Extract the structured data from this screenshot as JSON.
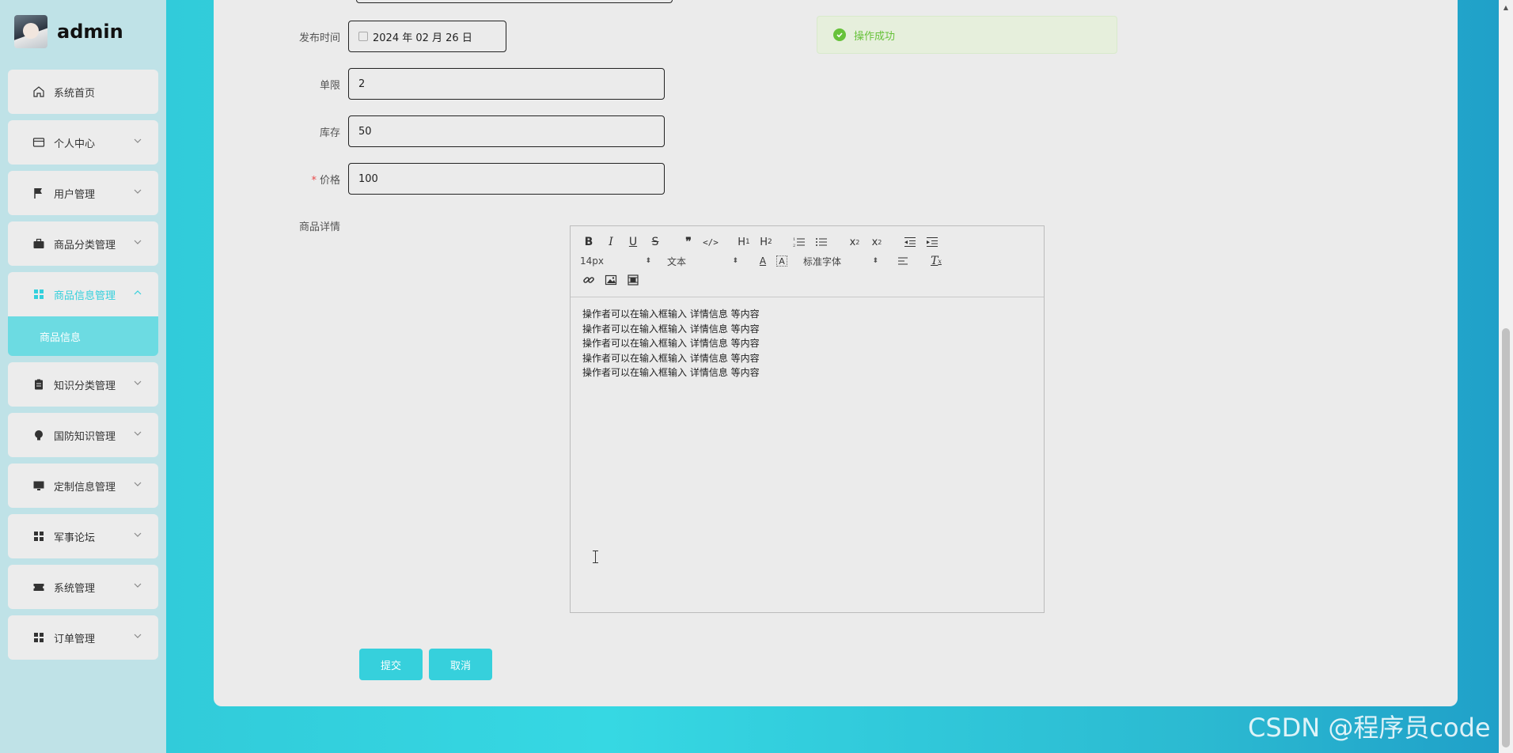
{
  "brand": {
    "name": "admin"
  },
  "sidebar": {
    "items": [
      {
        "label": "系统首页",
        "icon": "home-icon"
      },
      {
        "label": "个人中心",
        "icon": "id-card-icon"
      },
      {
        "label": "用户管理",
        "icon": "flag-icon"
      },
      {
        "label": "商品分类管理",
        "icon": "briefcase-icon"
      },
      {
        "label": "商品信息管理",
        "icon": "grid-icon"
      },
      {
        "label": "知识分类管理",
        "icon": "clipboard-icon"
      },
      {
        "label": "国防知识管理",
        "icon": "bulb-icon"
      },
      {
        "label": "定制信息管理",
        "icon": "monitor-icon"
      },
      {
        "label": "军事论坛",
        "icon": "grid-icon"
      },
      {
        "label": "系统管理",
        "icon": "ticket-icon"
      },
      {
        "label": "订单管理",
        "icon": "grid-icon"
      }
    ],
    "active_sub": "商品信息"
  },
  "form": {
    "publish_time": {
      "label": "发布时间",
      "value": "2024 年 02 月 26 日"
    },
    "limit": {
      "label": "单限",
      "value": "2"
    },
    "stock": {
      "label": "库存",
      "value": "50"
    },
    "price": {
      "label": "价格",
      "value": "100",
      "required_mark": "*"
    },
    "detail": {
      "label": "商品详情"
    }
  },
  "toast": {
    "text": "操作成功",
    "color": "#67c23a"
  },
  "editor": {
    "toolbar": {
      "font_size": "14px",
      "block_type": "文本",
      "font_family": "标准字体"
    },
    "lines": [
      "操作者可以在输入框输入  详情信息  等内容",
      "操作者可以在输入框输入  详情信息  等内容",
      "操作者可以在输入框输入  详情信息  等内容",
      "操作者可以在输入框输入  详情信息  等内容",
      "操作者可以在输入框输入  详情信息  等内容"
    ]
  },
  "actions": {
    "submit": "提交",
    "cancel": "取消"
  },
  "watermark": "CSDN @程序员code",
  "colors": {
    "accent": "#36d0dc",
    "sidebar_bg": "#bfe2e7",
    "card_bg": "#ebebeb"
  }
}
